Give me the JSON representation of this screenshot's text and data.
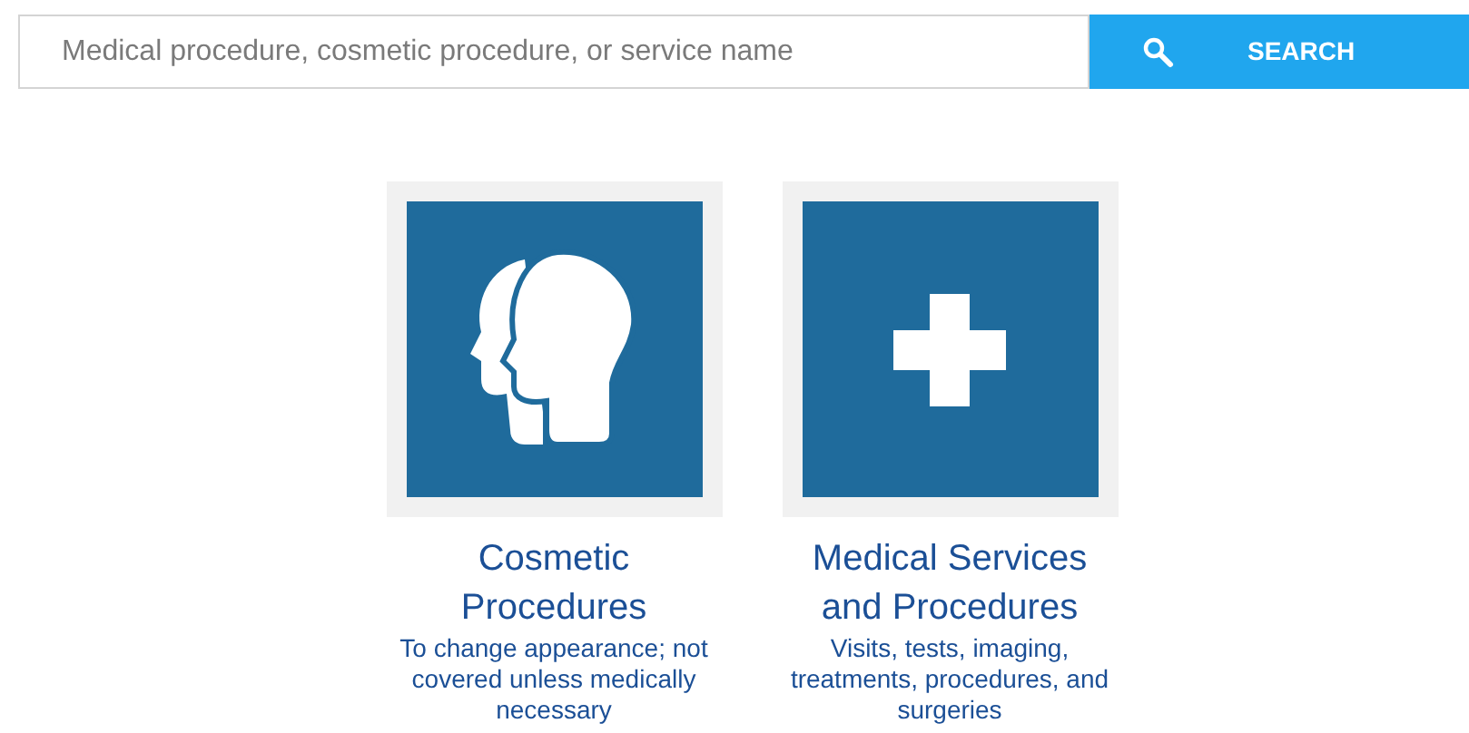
{
  "search": {
    "placeholder": "Medical procedure, cosmetic procedure, or service name",
    "button": "SEARCH"
  },
  "categories": [
    {
      "kind": "head",
      "title": "Cosmetic Procedures",
      "description": "To change appearance; not covered unless medically necessary"
    },
    {
      "kind": "cross",
      "title": "Medical Services and Procedures",
      "description": "Visits, tests, imaging, treatments, procedures, and surgeries"
    }
  ]
}
